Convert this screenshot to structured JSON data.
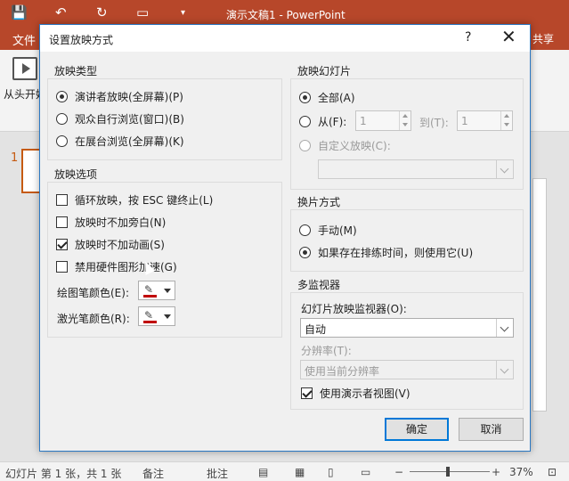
{
  "app": {
    "window_title": "演示文稿1 - PowerPoint",
    "tab_file": "文件",
    "tab_share": "共享",
    "ribbon_from_start": "从头开始",
    "slide_number": "1"
  },
  "status": {
    "slide_info": "幻灯片 第 1 张，共 1 张",
    "notes": "备注",
    "comments": "批注",
    "zoom_minus": "−",
    "zoom_plus": "+",
    "zoom": "37%"
  },
  "dialog": {
    "title": "设置放映方式",
    "help": "?",
    "close": "✕",
    "show_type": {
      "label": "放映类型",
      "options": [
        {
          "label": "演讲者放映(全屏幕)(P)",
          "selected": true
        },
        {
          "label": "观众自行浏览(窗口)(B)",
          "selected": false
        },
        {
          "label": "在展台浏览(全屏幕)(K)",
          "selected": false
        }
      ]
    },
    "show_options": {
      "label": "放映选项",
      "items": [
        {
          "label": "循环放映，按 ESC 键终止(L)",
          "checked": false
        },
        {
          "label": "放映时不加旁白(N)",
          "checked": false
        },
        {
          "label": "放映时不加动画(S)",
          "checked": true
        },
        {
          "label": "禁用硬件图形加速(G)",
          "checked": false
        }
      ],
      "pen_color_label": "绘图笔颜色(E):",
      "laser_color_label": "激光笔颜色(R):",
      "pen_color": "#c00000",
      "laser_color": "#c00000"
    },
    "show_slides": {
      "label": "放映幻灯片",
      "all": "全部(A)",
      "from": "从(F):",
      "from_value": "1",
      "to": "到(T):",
      "to_value": "1",
      "custom": "自定义放映(C):",
      "custom_value": ""
    },
    "advance": {
      "label": "换片方式",
      "manual": "手动(M)",
      "timings": "如果存在排练时间，则使用它(U)"
    },
    "monitors": {
      "label": "多监视器",
      "monitor_label": "幻灯片放映监视器(O):",
      "monitor_value": "自动",
      "resolution_label": "分辨率(T):",
      "resolution_value": "使用当前分辨率",
      "presenter_view": "使用演示者视图(V)"
    },
    "ok": "确定",
    "cancel": "取消"
  }
}
